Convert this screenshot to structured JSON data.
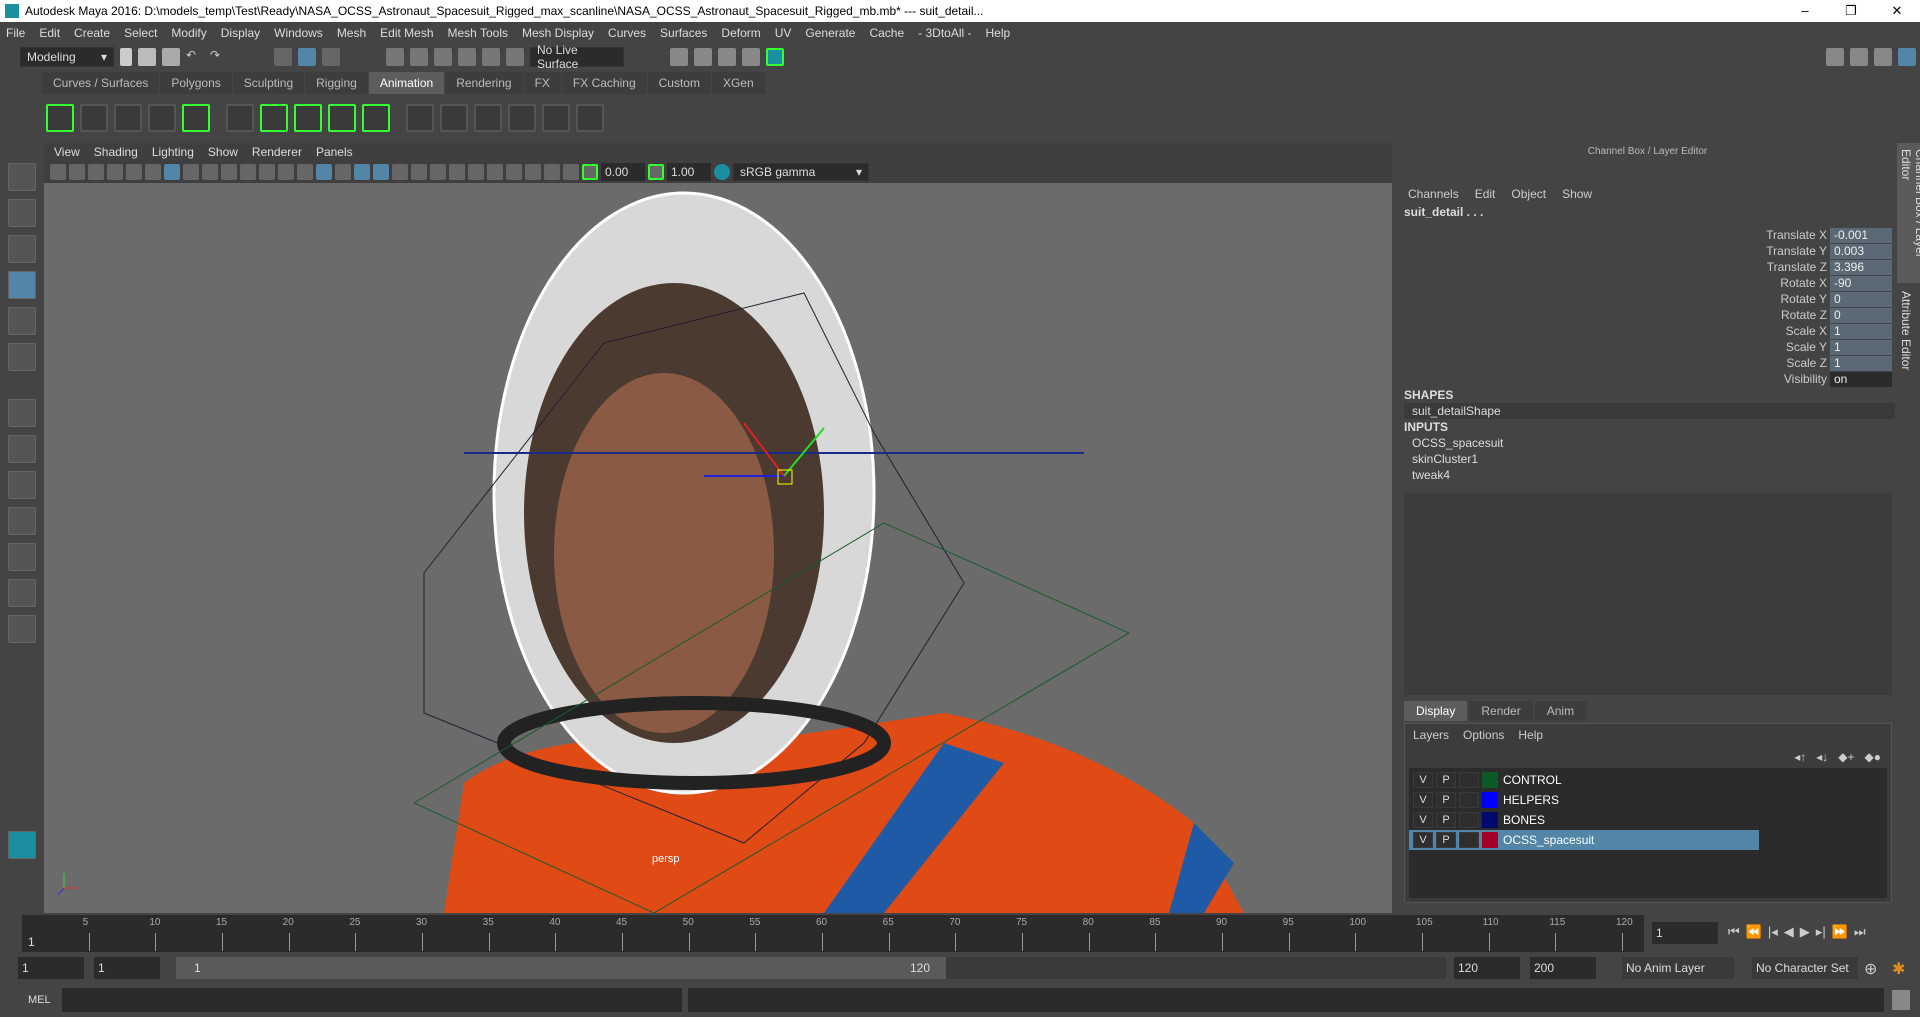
{
  "window": {
    "title": "Autodesk Maya 2016: D:\\models_temp\\Test\\Ready\\NASA_OCSS_Astronaut_Spacesuit_Rigged_max_scanline\\NASA_OCSS_Astronaut_Spacesuit_Rigged_mb.mb*   ---   suit_detail...",
    "minimize": "–",
    "maximize": "❐",
    "close": "✕"
  },
  "menu": [
    "File",
    "Edit",
    "Create",
    "Select",
    "Modify",
    "Display",
    "Windows",
    "Mesh",
    "Edit Mesh",
    "Mesh Tools",
    "Mesh Display",
    "Curves",
    "Surfaces",
    "Deform",
    "UV",
    "Generate",
    "Cache",
    "- 3DtoAll -",
    "Help"
  ],
  "status": {
    "menuset": "Modeling",
    "live_surface": "No Live Surface"
  },
  "shelf_tabs": [
    "Curves / Surfaces",
    "Polygons",
    "Sculpting",
    "Rigging",
    "Animation",
    "Rendering",
    "FX",
    "FX Caching",
    "Custom",
    "XGen"
  ],
  "shelf_active": "Animation",
  "viewport": {
    "menu": [
      "View",
      "Shading",
      "Lighting",
      "Show",
      "Renderer",
      "Panels"
    ],
    "exposure": "0.00",
    "gamma": "1.00",
    "color_space": "sRGB gamma",
    "camera_label": "persp"
  },
  "channel_box": {
    "title": "Channel Box / Layer Editor",
    "menu": [
      "Channels",
      "Edit",
      "Object",
      "Show"
    ],
    "object": "suit_detail . . .",
    "channels": [
      {
        "label": "Translate X",
        "value": "-0.001"
      },
      {
        "label": "Translate Y",
        "value": "0.003"
      },
      {
        "label": "Translate Z",
        "value": "3.396"
      },
      {
        "label": "Rotate X",
        "value": "-90"
      },
      {
        "label": "Rotate Y",
        "value": "0"
      },
      {
        "label": "Rotate Z",
        "value": "0"
      },
      {
        "label": "Scale X",
        "value": "1"
      },
      {
        "label": "Scale Y",
        "value": "1"
      },
      {
        "label": "Scale Z",
        "value": "1"
      },
      {
        "label": "Visibility",
        "value": "on"
      }
    ],
    "shapes_header": "SHAPES",
    "shapes": [
      "suit_detailShape"
    ],
    "inputs_header": "INPUTS",
    "inputs": [
      "OCSS_spacesuit",
      "skinCluster1",
      "tweak4"
    ]
  },
  "layer_editor": {
    "tabs": [
      "Display",
      "Render",
      "Anim"
    ],
    "menu": [
      "Layers",
      "Options",
      "Help"
    ],
    "layers": [
      {
        "v": "V",
        "p": "P",
        "name": "CONTROL",
        "color": "#0b5a26"
      },
      {
        "v": "V",
        "p": "P",
        "name": "HELPERS",
        "color": "#0000ff"
      },
      {
        "v": "V",
        "p": "P",
        "name": "BONES",
        "color": "#000a6e"
      },
      {
        "v": "V",
        "p": "P",
        "name": "OCSS_spacesuit",
        "color": "#a0002a",
        "selected": true
      }
    ]
  },
  "side_tabs": [
    "Channel Box / Layer Editor",
    "Attribute Editor"
  ],
  "timeline": {
    "ticks": [
      "5",
      "10",
      "15",
      "20",
      "25",
      "30",
      "35",
      "40",
      "45",
      "50",
      "55",
      "60",
      "65",
      "70",
      "75",
      "80",
      "85",
      "90",
      "95",
      "100",
      "105",
      "110",
      "115",
      "120"
    ],
    "start_marker": "1",
    "current_frame": "1"
  },
  "range": {
    "start": "1",
    "playback_start": "1",
    "slider_start": "1",
    "slider_end": "120",
    "playback_end": "120",
    "end": "200",
    "anim_layer": "No Anim Layer",
    "character_set": "No Character Set"
  },
  "command": {
    "label": "MEL"
  }
}
